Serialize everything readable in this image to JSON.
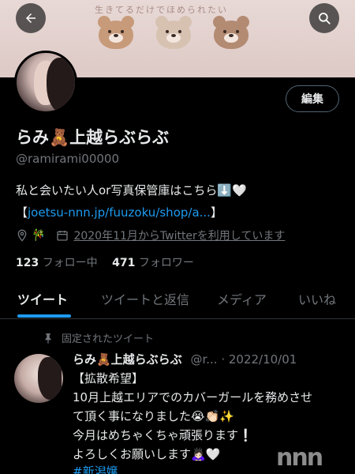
{
  "banner": {
    "caption": "生きてるだけでほめられたい",
    "colors": {
      "bear_brown": "#c79a7a",
      "bear_beige": "#d7c2b1",
      "bear_dark": "#b38b73"
    }
  },
  "header": {
    "back_icon": "arrow-left-icon",
    "search_icon": "search-icon"
  },
  "profile": {
    "edit_label": "編集",
    "name": "らみ🧸上越らぶらぶ",
    "handle": "@ramirami00000",
    "bio_line1": "私と会いたい人or写真保管庫はこちら⬇️🤍",
    "bio_link_prefix": "【",
    "bio_link": "joetsu-nnn.jp/fuuzoku/shop/a...",
    "bio_link_suffix": "】",
    "location_icon": "location-icon",
    "location_emoji": "🎋",
    "calendar_icon": "calendar-icon",
    "joined": "2020年11月からTwitterを利用しています",
    "following_count": "123",
    "following_label": "フォロー中",
    "followers_count": "471",
    "followers_label": "フォロワー"
  },
  "tabs": [
    {
      "label": "ツイート",
      "active": true
    },
    {
      "label": "ツイートと返信",
      "active": false
    },
    {
      "label": "メディア",
      "active": false
    },
    {
      "label": "いいね",
      "active": false
    }
  ],
  "tweet": {
    "pinned_label": "固定されたツイート",
    "author": "らみ🧸上越らぶらぶ",
    "handle_date": "@r... · 2022/10/01",
    "lines": [
      "【拡散希望】",
      "10月上越エリアでのカバーガールを務めさせ",
      "て頂く事になりました😭👏🏻✨",
      "今月はめちゃくちゃ頑張ります❕",
      "よろしくお願いします🙇🏻‍♀️🤍"
    ],
    "hashtag": "#新潟嬢"
  },
  "watermark": "nnn",
  "colors": {
    "accent": "#1d9bf0",
    "text": "#e7e9ea",
    "muted": "#71767b",
    "background": "#000000",
    "border": "#2f3336"
  }
}
